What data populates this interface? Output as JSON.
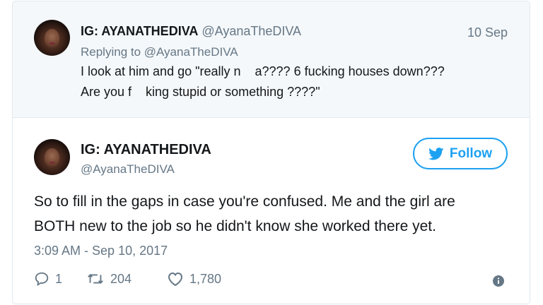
{
  "reply_tweet": {
    "display_name": "IG: AYANATHEDIVA",
    "handle": "@AyanaTheDIVA",
    "date": "10 Sep",
    "replying_to": "Replying to @AyanaTheDIVA",
    "text_line1": "I look at him and go \"really n    a???? 6 fucking houses down???",
    "text_line2": "Are you f    king stupid or something ????\""
  },
  "main_tweet": {
    "display_name": "IG: AYANATHEDIVA",
    "handle": "@AyanaTheDIVA",
    "follow_label": "Follow",
    "text_line1": "So to fill in the gaps in case you're confused. Me and the girl are",
    "text_line2": "BOTH new to the job so he didn't know she worked there yet.",
    "timestamp": "3:09 AM - Sep 10, 2017",
    "replies": "1",
    "retweets": "204",
    "likes": "1,780"
  },
  "icons": {
    "reply": "reply-icon",
    "retweet": "retweet-icon",
    "like": "heart-icon",
    "info": "info-icon",
    "twitter": "twitter-bird-icon"
  },
  "colors": {
    "accent": "#1da1f2",
    "muted": "#657786",
    "reply_bg": "#f5f8fa"
  }
}
